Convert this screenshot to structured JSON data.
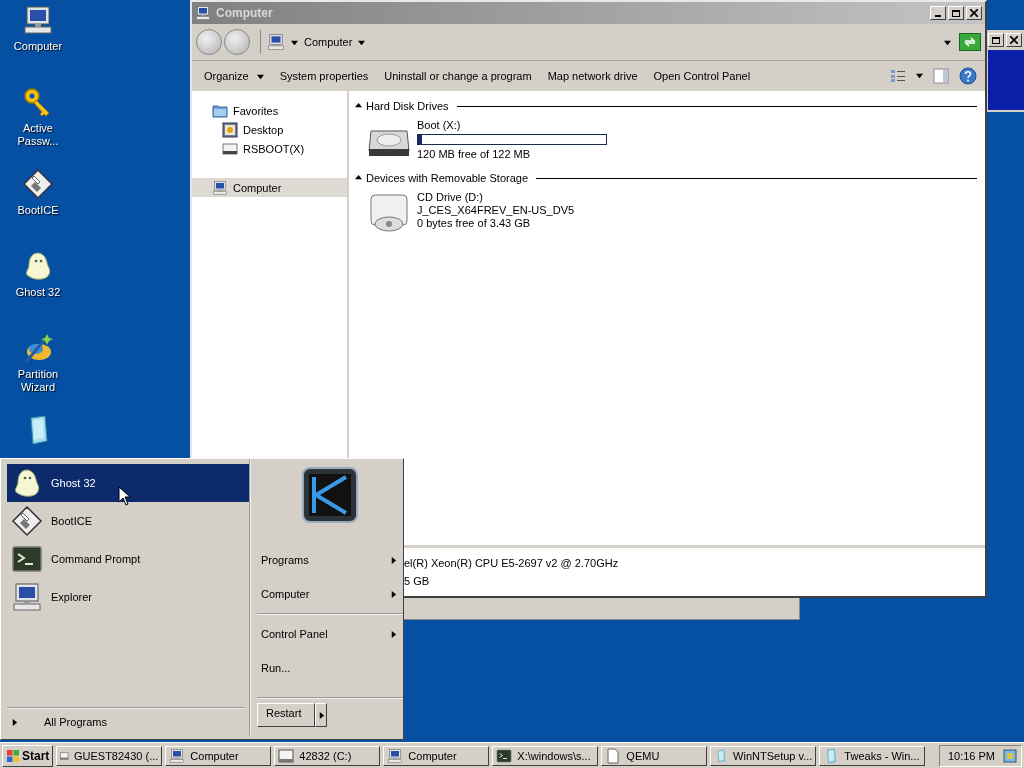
{
  "desktop_icons": [
    {
      "kind": "computer",
      "label": "Computer"
    },
    {
      "kind": "key",
      "label": "Active Passw..."
    },
    {
      "kind": "floppy",
      "label": "BootICE"
    },
    {
      "kind": "ghost",
      "label": "Ghost 32"
    },
    {
      "kind": "wand",
      "label": "Partition Wizard"
    },
    {
      "kind": "setup"
    }
  ],
  "explorer": {
    "title": "Computer",
    "address": "Computer",
    "toolbar": [
      {
        "label": "Organize",
        "dropdown": true
      },
      {
        "label": "System properties",
        "dropdown": false
      },
      {
        "label": "Uninstall or change a program",
        "dropdown": false
      },
      {
        "label": "Map network drive",
        "dropdown": false
      },
      {
        "label": "Open Control Panel",
        "dropdown": false
      }
    ],
    "nav": [
      {
        "kind": "folder",
        "label": "Favorites",
        "selected": false,
        "children": [
          {
            "kind": "desktop",
            "label": "Desktop",
            "selected": false
          },
          {
            "kind": "drive",
            "label": "RSBOOT(X)",
            "selected": false
          }
        ]
      },
      {
        "kind": "computer",
        "label": "Computer",
        "selected": true
      }
    ],
    "groups": [
      {
        "title": "Hard Disk Drives",
        "drives": [
          {
            "kind": "harddisk",
            "name": "Boot (X:)",
            "level": 0.02,
            "lines": [
              "120 MB free of 122 MB"
            ]
          }
        ]
      },
      {
        "title": "Devices with Removable Storage",
        "drives": [
          {
            "kind": "cdrom",
            "name": "CD Drive (D:)",
            "lines": [
              "J_CES_X64FREV_EN-US_DV5",
              "0 bytes free of 3.43 GB"
            ]
          }
        ]
      }
    ],
    "details": [
      "el(R) Xeon(R) CPU E5-2697 v2 @ 2.70GHz",
      "5 GB"
    ]
  },
  "start_menu": {
    "pinned": [
      {
        "kind": "ghost",
        "label": "Ghost 32",
        "selected": true
      },
      {
        "kind": "floppy",
        "label": "BootICE",
        "selected": false
      },
      {
        "kind": "console",
        "label": "Command Prompt",
        "selected": false
      },
      {
        "kind": "computer",
        "label": "Explorer",
        "selected": false
      }
    ],
    "all_programs": "All Programs",
    "places": [
      [
        {
          "label": "Programs",
          "submenu": true
        },
        {
          "label": "Computer",
          "submenu": true
        }
      ],
      [
        {
          "label": "Control Panel",
          "submenu": true
        },
        {
          "label": "Run...",
          "submenu": false
        }
      ]
    ],
    "restart": "Restart"
  },
  "taskbar": {
    "start": "Start",
    "tasks": [
      {
        "kind": "window",
        "label": "GUEST82430 (..."
      },
      {
        "kind": "computer",
        "label": "Computer"
      },
      {
        "kind": "window",
        "label": "42832 (C:)"
      },
      {
        "kind": "computer",
        "label": "Computer"
      },
      {
        "kind": "console",
        "label": "X:\\windows\\s..."
      },
      {
        "kind": "doc",
        "label": "QEMU"
      },
      {
        "kind": "setup",
        "label": "WinNTSetup v..."
      },
      {
        "kind": "setup",
        "label": "Tweaks - Win..."
      }
    ],
    "clock": "10:16 PM"
  }
}
